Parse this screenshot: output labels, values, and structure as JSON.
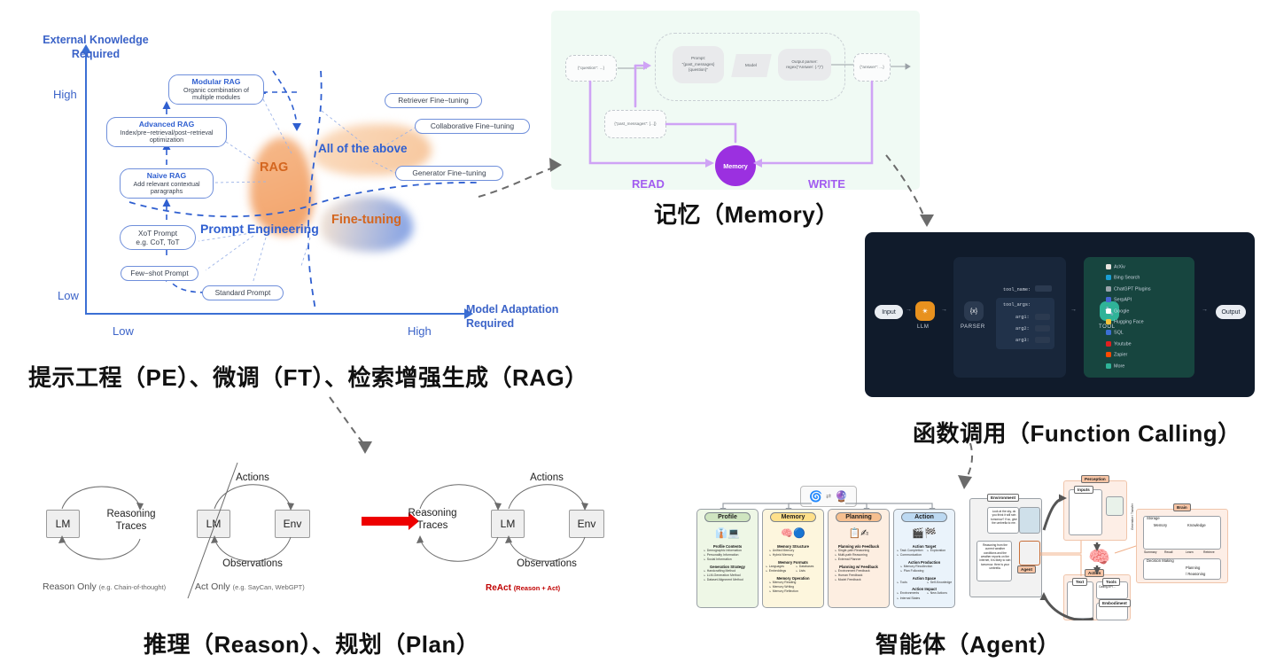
{
  "captions": {
    "pe_ft_rag": "提示工程（PE）、微调（FT）、检索增强生成（RAG）",
    "memory": "记忆（Memory）",
    "function_calling": "函数调用（Function Calling）",
    "reason_plan": "推理（Reason）、规划（Plan）",
    "agent": "智能体（Agent）"
  },
  "colors": {
    "axis_blue": "#3b6fd4",
    "node_blue": "#2f5fd0",
    "rag_orange": "#d4661f",
    "memory_purple": "#9b30e0",
    "react_red": "#c00000",
    "fc_dark": "#101b2b",
    "fc_orange": "#e8911e",
    "fc_green": "#2fb398"
  },
  "quadrant": {
    "y_axis_title": "External Knowledge\nRequired",
    "y_axis_title_line1": "External Knowledge",
    "y_axis_title_line2": "Required",
    "y_high": "High",
    "y_low": "Low",
    "x_axis_title_line1": "Model Adaptation",
    "x_axis_title_line2": "Required",
    "x_low": "Low",
    "x_high": "High",
    "blobs": [
      {
        "label": "RAG",
        "color": "#f0a36a"
      },
      {
        "label": "Fine-tuning",
        "color": "#8ca8e8"
      },
      {
        "label": "All of the above",
        "color": "#f5c79b"
      },
      {
        "label": "Prompt Engineering",
        "color": "#2f5fd0"
      }
    ],
    "nodes": [
      {
        "title": "Modular RAG",
        "subtitle": "Organic combination of\nmultiple modules"
      },
      {
        "title": "Advanced RAG",
        "subtitle": "Index/pre−retrieval/post−retrieval\noptimization"
      },
      {
        "title": "Naive RAG",
        "subtitle": "Add relevant contextual\nparagraphs"
      },
      {
        "title": "XoT Prompt\ne.g. CoT, ToT",
        "subtitle": ""
      },
      {
        "title": "Few−shot Prompt",
        "subtitle": ""
      },
      {
        "title": "Standard Prompt",
        "subtitle": ""
      },
      {
        "title": "Retriever Fine−tuning",
        "subtitle": ""
      },
      {
        "title": "Collaborative Fine−tuning",
        "subtitle": ""
      },
      {
        "title": "Generator Fine−tuning",
        "subtitle": ""
      }
    ],
    "n0_title": "Modular RAG",
    "n0_sub1": "Organic combination of",
    "n0_sub2": "multiple modules",
    "n1_title": "Advanced RAG",
    "n1_sub1": "Index/pre−retrieval/post−retrieval",
    "n1_sub2": "optimization",
    "n2_title": "Naive RAG",
    "n2_sub1": "Add relevant contextual",
    "n2_sub2": "paragraphs",
    "n3_l1": "XoT Prompt",
    "n3_l2": "e.g. CoT, ToT",
    "n4": "Few−shot Prompt",
    "n5": "Standard Prompt",
    "n6": "Retriever Fine−tuning",
    "n7": "Collaborative Fine−tuning",
    "n8": "Generator Fine−tuning",
    "blob_rag": "RAG",
    "blob_ft": "Fine-tuning",
    "blob_all": "All of the above",
    "blob_pe": "Prompt Engineering"
  },
  "memory_diagram": {
    "question_node": "{\"question\": ...}",
    "past_messages_node": "{\"past_messages\": [...]}",
    "prompt_node_l1": "Prompt:",
    "prompt_node_l2": "\"{past_messages}",
    "prompt_node_l3": "{question}\"",
    "model_node": "Model",
    "parser_node_l1": "Output parser:",
    "parser_node_l2": "regex(\"Answer: (.*)\")",
    "answer_node": "{\"answer\": ...}",
    "memory_label": "Memory",
    "read_label": "READ",
    "write_label": "WRITE"
  },
  "function_calling": {
    "input": "Input",
    "llm": "LLM",
    "parser": "PARSER",
    "parser_glyph": "{x}",
    "tool": "TOOL",
    "output": "Output",
    "tool_name_key": "tool_name:",
    "tool_args_key": "tool_args:",
    "args": [
      "arg1:",
      "arg2:",
      "arg3:"
    ],
    "dots": "...",
    "tools": [
      {
        "name": "ArXiv",
        "color": "#e7e3de"
      },
      {
        "name": "Bing Search",
        "color": "#1a9ed4"
      },
      {
        "name": "ChatGPT Plugins",
        "color": "#9aa3ab"
      },
      {
        "name": "SerpAPI",
        "color": "#4666d6"
      },
      {
        "name": "Google",
        "color": "#ffffff"
      },
      {
        "name": "Hugging Face",
        "color": "#f5c33b"
      },
      {
        "name": "SQL",
        "color": "#3b6fd4"
      },
      {
        "name": "Youtube",
        "color": "#e02020"
      },
      {
        "name": "Zapier",
        "color": "#ff4a00"
      },
      {
        "name": "More",
        "color": "#2fb398"
      }
    ]
  },
  "react": {
    "lm": "LM",
    "env": "Env",
    "reasoning_l1": "Reasoning",
    "reasoning_l2": "Traces",
    "actions": "Actions",
    "observations": "Observations",
    "reason_only": "Reason Only",
    "reason_only_eg": "(e.g. Chain-of-thought)",
    "act_only": "Act Only",
    "act_only_eg": "(e.g. SayCan, WebGPT)",
    "react_title": "ReAct",
    "react_sub": "(Reason + Act)"
  },
  "agent_columns": [
    {
      "title": "Profile",
      "color": "#cfe5c0",
      "bg": "#eef7e6",
      "icons": "👔💻",
      "sections": [
        {
          "heading": "Profile Contents",
          "items": [
            "Demographic Information",
            "Personality Information",
            "Social Information"
          ],
          "two_col": false
        },
        {
          "heading": "Generation Strategy",
          "items": [
            "Handcrafting Method",
            "LLM-Generation Method",
            "Dataset Alignment Method"
          ],
          "two_col": false
        }
      ]
    },
    {
      "title": "Memory",
      "color": "#ffe08a",
      "bg": "#fdf6dd",
      "icons": "🧠🔵",
      "sections": [
        {
          "heading": "Memory Structure",
          "items": [
            "Unified Memory",
            "Hybrid Memory"
          ],
          "two_col": false
        },
        {
          "heading": "Memory Formats",
          "items": [
            "Languages",
            "Databases",
            "Embeddings",
            "Lists"
          ],
          "two_col": true
        },
        {
          "heading": "Memory Operation",
          "items": [
            "Memory Reading",
            "Memory Writing",
            "Memory Reflection"
          ],
          "two_col": false
        }
      ]
    },
    {
      "title": "Planning",
      "color": "#f6bf8f",
      "bg": "#fdeee1",
      "icons": "📋✍",
      "sections": [
        {
          "heading": "Planning w/o Feedback",
          "items": [
            "Single-path Reasoning",
            "Multi-path Reasoning",
            "External Planner"
          ],
          "two_col": false
        },
        {
          "heading": "Planning w/ Feedback",
          "items": [
            "Environment Feedback",
            "Human Feedback",
            "Model Feedback"
          ],
          "two_col": false
        }
      ]
    },
    {
      "title": "Action",
      "color": "#bcd9f2",
      "bg": "#eaf3fb",
      "icons": "🎬🏁",
      "sections": [
        {
          "heading": "Action Target",
          "items": [
            "Task Completion",
            "Exploration",
            "Communication"
          ],
          "two_col": true
        },
        {
          "heading": "Action Production",
          "items": [
            "Memory Recollection",
            "Plan Following"
          ],
          "two_col": false
        },
        {
          "heading": "Action Space",
          "items": [
            "Tools",
            "Self-Knowledge"
          ],
          "two_col": true
        },
        {
          "heading": "Action Impact",
          "items": [
            "Environments",
            "New Actions",
            "Internal States"
          ],
          "two_col": true
        }
      ]
    }
  ],
  "agent_arch": {
    "perception": "Perception",
    "inputs": "Inputs",
    "environment": "Environment",
    "agent": "Agent",
    "brain": "Brain",
    "storage": "Storage",
    "memory": "Memory",
    "knowledge": "Knowledge",
    "decision_making": "Decision Making",
    "planning": "Planning",
    "reasoning": "/ Reasoning",
    "summary": "Summary",
    "recall": "Recall",
    "learn": "Learn",
    "retrieve": "Retrieve",
    "generalize": "Generalize / Transfer",
    "action": "Action",
    "text": "Text",
    "tools": "Tools",
    "calling_api": "Calling API ...",
    "embodiment": "Embodiment",
    "bubble_user": "Look at the sky, do you think it will rain tomorrow? If so, give the umbrella to me.",
    "bubble_agent": "Reasoning from the current weather conditions and the weather reports on the internet, it is likely to rain tomorrow. Here is your umbrella.",
    "dots": "..."
  }
}
